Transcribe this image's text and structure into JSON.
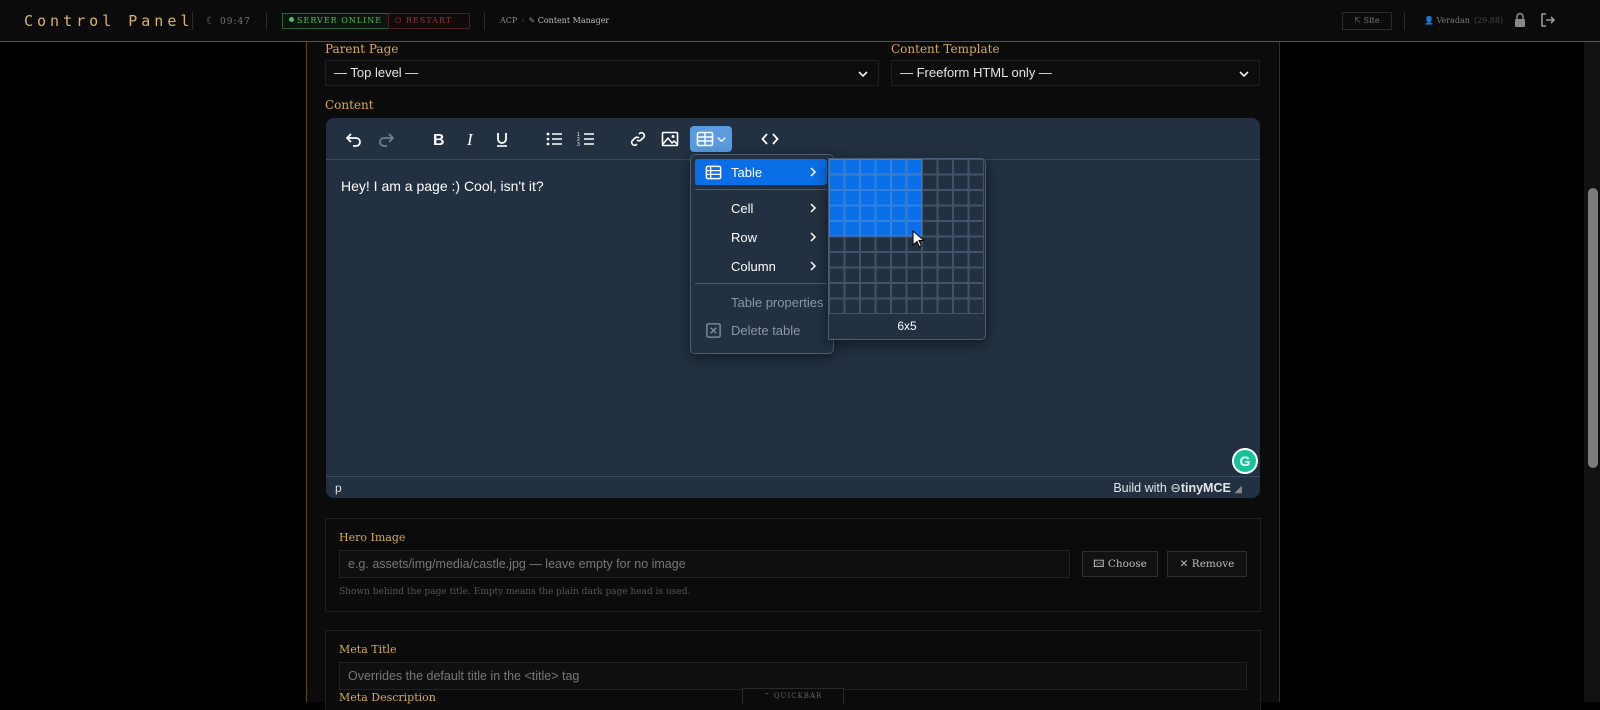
{
  "topbar": {
    "brand": "Control Panel",
    "clock": "09:47",
    "server_status": "SERVER ONLINE",
    "restart_label": "RESTART",
    "breadcrumb": {
      "root": "ACP",
      "current": "Content Manager"
    },
    "site_label": "Site",
    "user_name": "Veradan",
    "user_level": "(29.88)"
  },
  "form": {
    "parent_page": {
      "label": "Parent Page",
      "value": "— Top level —"
    },
    "content_template": {
      "label": "Content Template",
      "value": "— Freeform HTML only —"
    },
    "content_label": "Content"
  },
  "editor": {
    "body_text": "Hey! I am a page :) Cool, isn't it?",
    "status_path": "p",
    "branding_prefix": "Build with",
    "branding_name": "tinyMCE",
    "toolbar_icons": [
      "undo-icon",
      "redo-icon",
      "bold-icon",
      "italic-icon",
      "underline-icon",
      "bullet-list-icon",
      "numbered-list-icon",
      "link-icon",
      "image-icon",
      "table-icon",
      "code-icon"
    ]
  },
  "table_menu": {
    "items": [
      {
        "label": "Table",
        "has_submenu": true,
        "active": true
      },
      {
        "label": "Cell",
        "has_submenu": true
      },
      {
        "label": "Row",
        "has_submenu": true
      },
      {
        "label": "Column",
        "has_submenu": true
      },
      {
        "label": "Table properties",
        "disabled": true
      },
      {
        "label": "Delete table",
        "disabled": true
      }
    ]
  },
  "table_picker": {
    "size_label": "6x5",
    "columns": 10,
    "rows": 10,
    "selected_cols": 6,
    "selected_rows": 5,
    "highlight_color": "#0a6fe6"
  },
  "hero_image": {
    "label": "Hero Image",
    "placeholder": "e.g. assets/img/media/castle.jpg — leave empty for no image",
    "choose_label": "Choose",
    "remove_label": "Remove",
    "hint": "Shown behind the page title. Empty means the plain dark page head is used."
  },
  "meta": {
    "title_label": "Meta Title",
    "title_placeholder": "Overrides the default title in the <title> tag",
    "description_label": "Meta Description"
  },
  "quickbar_label": "QUICKBAR",
  "colors": {
    "accent_gold": "#d6a95c",
    "online_green": "#4fbf63",
    "editor_bg": "#223041",
    "menu_active": "#0a6fe6"
  }
}
